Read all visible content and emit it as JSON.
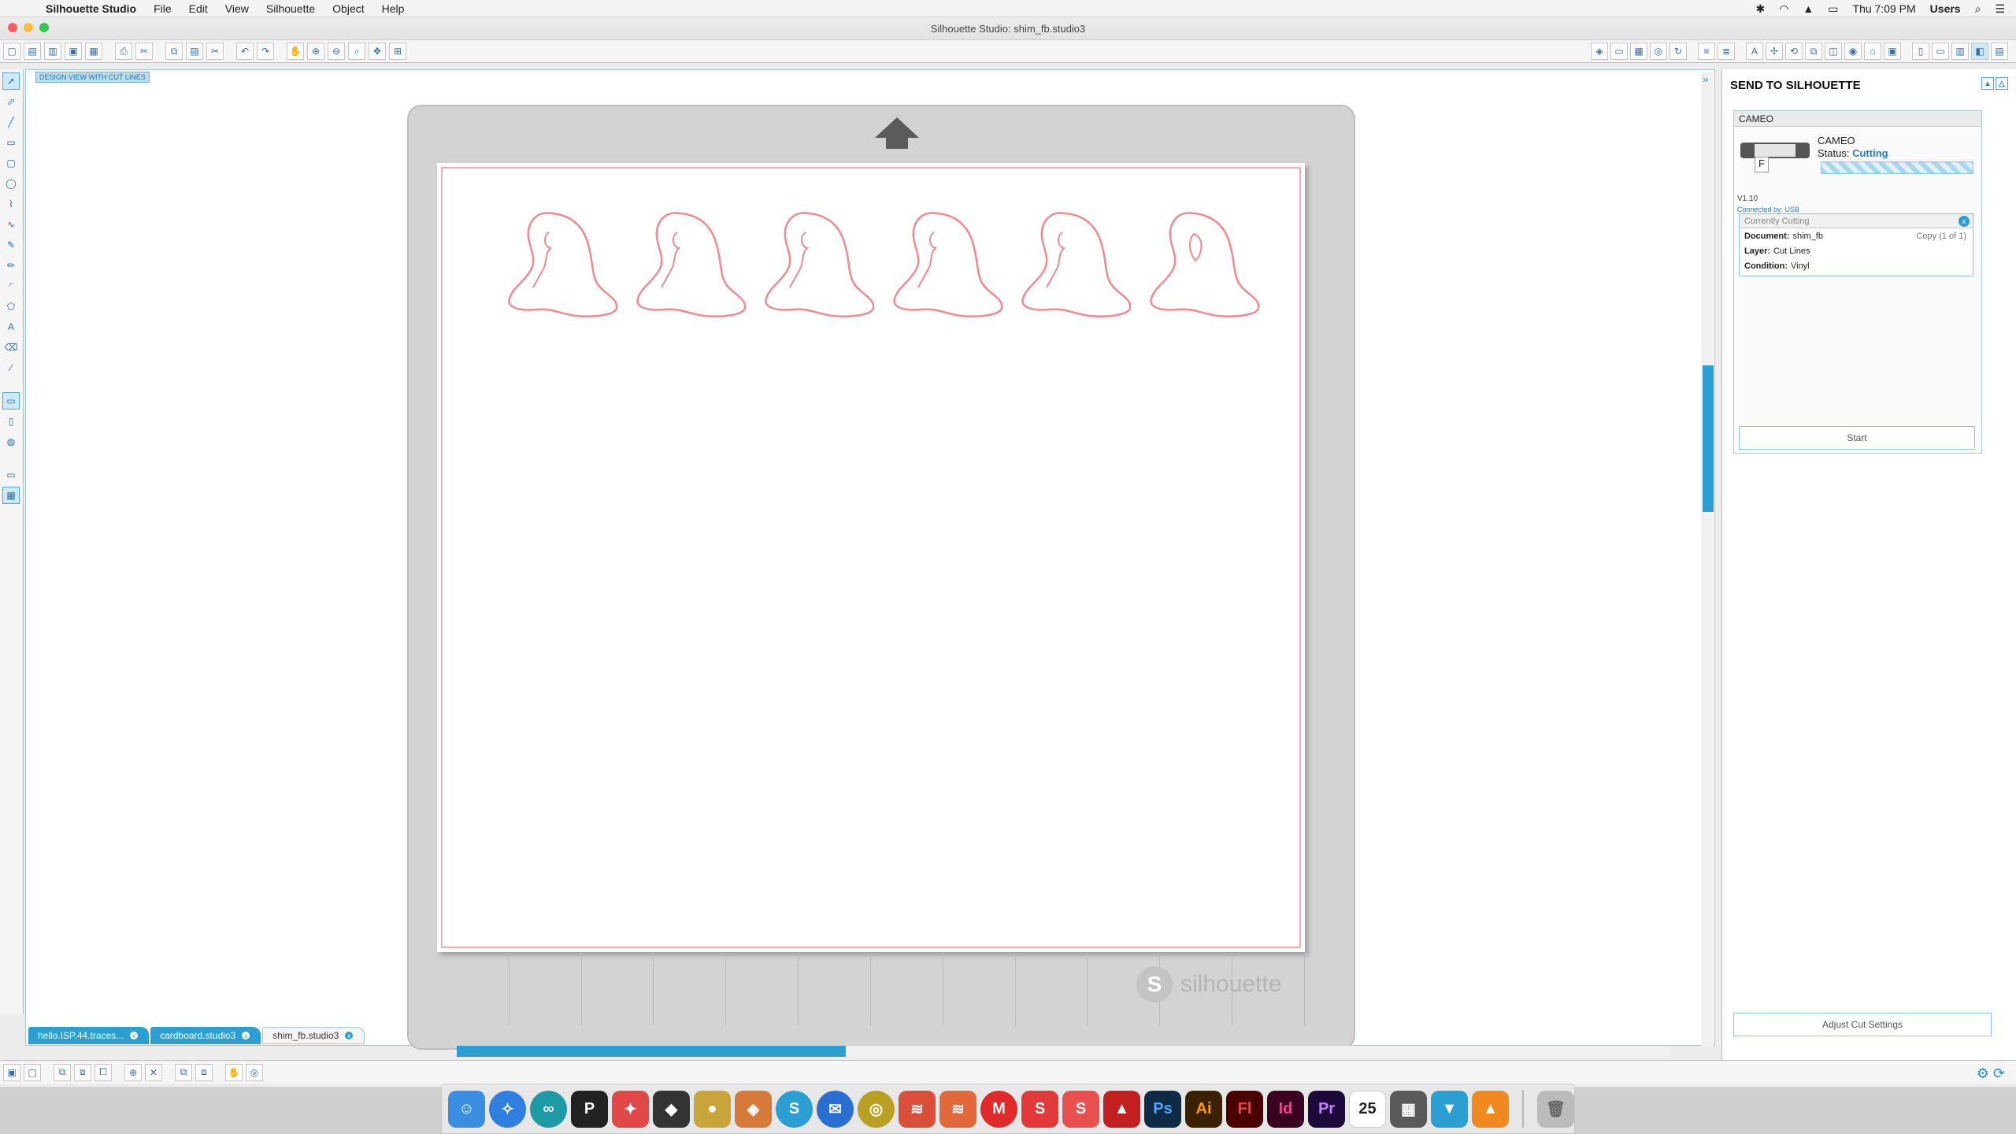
{
  "menubar": {
    "app_name": "Silhouette Studio",
    "items": [
      "File",
      "Edit",
      "View",
      "Silhouette",
      "Object",
      "Help"
    ],
    "clock": "Thu 7:09 PM",
    "user": "Users"
  },
  "window": {
    "title": "Silhouette Studio: shim_fb.studio3"
  },
  "canvas": {
    "view_tag": "DESIGN VIEW WITH CUT LINES",
    "mat_logo_text": "silhouette",
    "figure_count": 6
  },
  "tabs": [
    {
      "label": "hello.ISP.44.traces..."
    },
    {
      "label": "cardboard.studio3"
    },
    {
      "label": "shim_fb.studio3"
    }
  ],
  "panel": {
    "title": "SEND TO SILHOUETTE",
    "device_header": "CAMEO",
    "device_name": "CAMEO",
    "status_label": "Status:",
    "status_value": "Cutting",
    "version": "V1.10",
    "connected_by": "Connected by: USB",
    "currently_cutting": "Currently Cutting",
    "document_label": "Document:",
    "document_value": "shim_fb",
    "copy_text": "Copy (1 of 1)",
    "layer_label": "Layer:",
    "layer_value": "Cut Lines",
    "condition_label": "Condition:",
    "condition_value": "Vinyl",
    "start_label": "Start",
    "adjust_label": "Adjust Cut Settings"
  },
  "colors": {
    "accent": "#2b9fd2",
    "cut_line": "#f08a90",
    "status": "#2b7fc0"
  },
  "dock_apps": [
    "Finder",
    "Safari",
    "Arduino",
    "Pixelmator",
    "Inkscape",
    "Blender",
    "Cinema 4D",
    "Fusion",
    "Silhouette Studio",
    "Mail",
    "Circle",
    "Brush",
    "Brush 2",
    "MakerBot",
    "SketchUp",
    "SketchUp 2",
    "Autodesk",
    "Ps",
    "Ai",
    "Fl",
    "Id",
    "Pr",
    "Calendar",
    "Calculator",
    "Vector",
    "VLC",
    "Trash"
  ],
  "dock_labels": {
    "ps": "Ps",
    "ai": "Ai",
    "fl": "Fl",
    "id": "Id",
    "pr": "Pr",
    "cal": "25",
    "pixel": "P"
  }
}
